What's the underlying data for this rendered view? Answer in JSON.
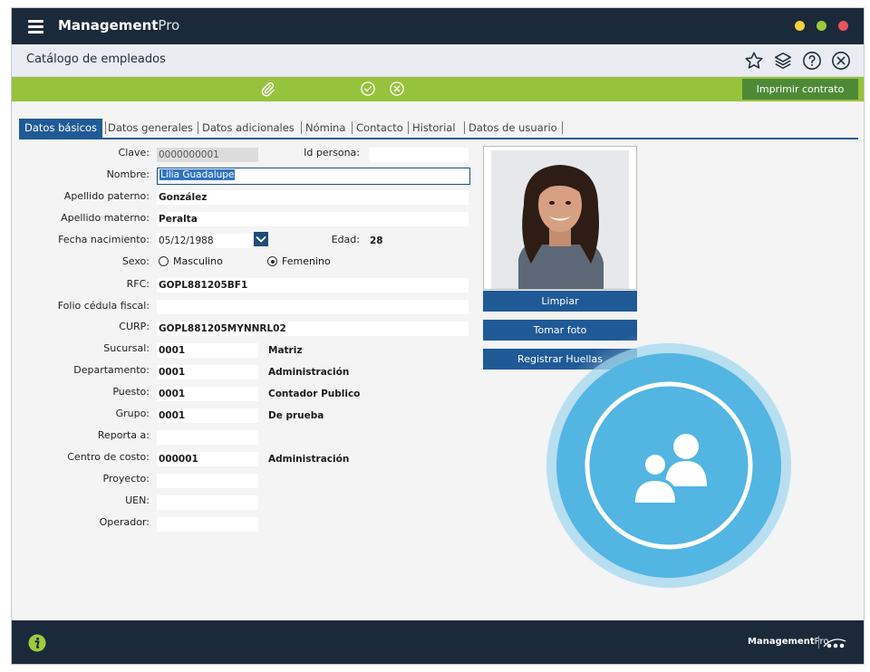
{
  "app": {
    "name_bold": "Management",
    "name_light": "Pro"
  },
  "page": {
    "title": "Catálogo de empleados"
  },
  "toolbar": {
    "print_label": "Imprimir contrato"
  },
  "tabs": [
    {
      "label": "Datos básicos"
    },
    {
      "label": "Datos generales"
    },
    {
      "label": "Datos adicionales"
    },
    {
      "label": "Nómina"
    },
    {
      "label": "Contacto"
    },
    {
      "label": "Historial"
    },
    {
      "label": "Datos de usuario"
    }
  ],
  "form": {
    "clave": {
      "label": "Clave:",
      "value": "0000000001"
    },
    "id_persona": {
      "label": "Id persona:",
      "value": ""
    },
    "nombre": {
      "label": "Nombre:",
      "value": "Lilia Guadalupe"
    },
    "apellido_paterno": {
      "label": "Apellido paterno:",
      "value": "González"
    },
    "apellido_materno": {
      "label": "Apellido materno:",
      "value": "Peralta"
    },
    "fecha_nacimiento": {
      "label": "Fecha nacimiento:",
      "value": "05/12/1988"
    },
    "edad": {
      "label": "Edad:",
      "value": "28"
    },
    "sexo": {
      "label": "Sexo:",
      "options": [
        "Masculino",
        "Femenino"
      ],
      "selected": "Femenino"
    },
    "rfc": {
      "label": "RFC:",
      "value": "GOPL881205BF1"
    },
    "folio_cedula": {
      "label": "Folio cédula fiscal:",
      "value": ""
    },
    "curp": {
      "label": "CURP:",
      "value": "GOPL881205MYNNRL02"
    },
    "sucursal": {
      "label": "Sucursal:",
      "value": "0001",
      "desc": "Matriz"
    },
    "departamento": {
      "label": "Departamento:",
      "value": "0001",
      "desc": "Administración"
    },
    "puesto": {
      "label": "Puesto:",
      "value": "0001",
      "desc": "Contador Publico"
    },
    "grupo": {
      "label": "Grupo:",
      "value": "0001",
      "desc": "De prueba"
    },
    "reporta_a": {
      "label": "Reporta a:",
      "value": ""
    },
    "centro_costo": {
      "label": "Centro de costo:",
      "value": "000001",
      "desc": "Administración"
    },
    "proyecto": {
      "label": "Proyecto:",
      "value": ""
    },
    "uen": {
      "label": "UEN:",
      "value": ""
    },
    "operador": {
      "label": "Operador:",
      "value": ""
    }
  },
  "photo_actions": {
    "clear": "Limpiar",
    "take": "Tomar foto",
    "fingerprint": "Registrar Huellas"
  },
  "footer": {
    "brand_bold": "Management",
    "brand_light": "Pro"
  },
  "colors": {
    "titlebar": "#1b2a3b",
    "toolbar": "#97c23c",
    "print_button": "#4e8a35",
    "primary": "#1f5a96",
    "circle": "#4fb3e0",
    "win_yellow": "#f4d03f",
    "win_green": "#9ccc3c",
    "win_red": "#e9545b",
    "info": "#9ccc3c"
  }
}
